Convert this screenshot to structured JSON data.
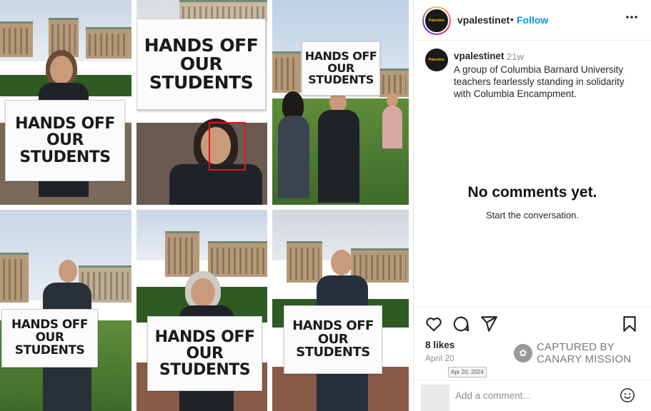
{
  "post": {
    "username": "vpalestinet",
    "follow_label": "Follow",
    "separator": "•",
    "avatar_text": "Palestine"
  },
  "caption": {
    "username": "vpalestinet",
    "time": "21w",
    "text": "A group of Columbia Barnard University teachers fearlessly standing in solidarity with Columbia Encampment."
  },
  "comments": {
    "empty_title": "No comments yet.",
    "empty_subtitle": "Start the conversation.",
    "add_placeholder": "Add a comment..."
  },
  "stats": {
    "likes": "8 likes",
    "date": "April 20",
    "date_tooltip": "Apr 20, 2024"
  },
  "watermark": {
    "line1": "CAPTURED BY",
    "line2": "CANARY MISSION"
  },
  "signs": [
    {
      "line1": "HANDS OFF",
      "line2": "OUR STUDENTS"
    },
    {
      "line1": "HANDS OFF",
      "line2": "OUR STUDENTS"
    },
    {
      "line1": "HANDS OFF",
      "line2": "OUR STUDENTS"
    },
    {
      "line1": "HANDS OFF",
      "line2": "OUR STUDENTS"
    },
    {
      "line1": "HANDS OFF",
      "line2": "OUR STUDENTS"
    },
    {
      "line1": "HANDS OFF",
      "line2": "OUR STUDENTS"
    }
  ],
  "icons": [
    "heart-icon",
    "comment-icon",
    "share-icon",
    "bookmark-icon",
    "more-options-icon",
    "emoji-icon"
  ],
  "colors": {
    "accent": "#0095f6",
    "face_box": "#e0151b"
  }
}
